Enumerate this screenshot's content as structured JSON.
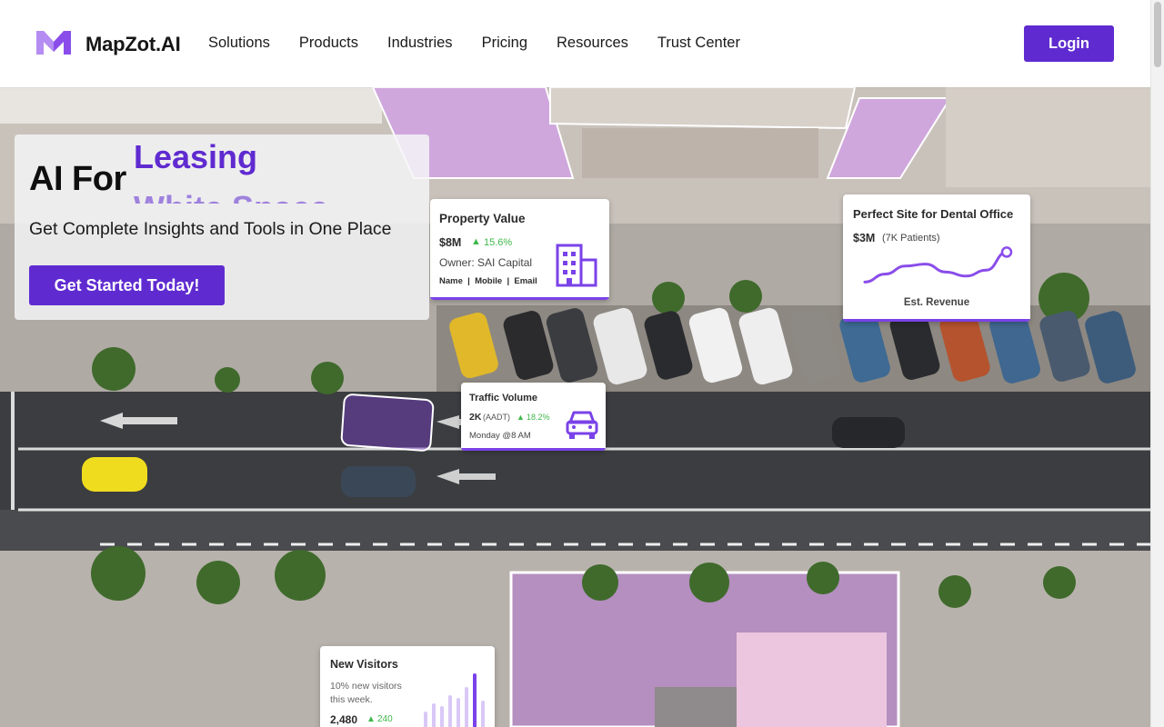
{
  "brand": {
    "name": "MapZot.AI",
    "logo_icon": "m-logo-icon",
    "accent": "#5f2bd0"
  },
  "nav": {
    "items": [
      {
        "label": "Solutions"
      },
      {
        "label": "Products"
      },
      {
        "label": "Industries"
      },
      {
        "label": "Pricing"
      },
      {
        "label": "Resources"
      },
      {
        "label": "Trust Center"
      }
    ],
    "login_label": "Login"
  },
  "hero": {
    "prefix": "AI For",
    "rotating_words": [
      "Leasing",
      "White Space"
    ],
    "subtitle": "Get Complete Insights and Tools in One Place",
    "cta_label": "Get Started Today!"
  },
  "cards": {
    "property": {
      "title": "Property Value",
      "value": "$8M",
      "change": "15.6%",
      "owner": "Owner: SAI Capital",
      "fields": "Name  |  Mobile  |  Email",
      "icon": "building-icon"
    },
    "dental": {
      "title": "Perfect Site for Dental Office",
      "value": "$3M",
      "detail": "(7K Patients)",
      "caption": "Est. Revenue",
      "trend": [
        0.15,
        0.35,
        0.55,
        0.6,
        0.4,
        0.3,
        0.45,
        0.9
      ]
    },
    "traffic": {
      "title": "Traffic Volume",
      "value": "2K",
      "unit": "(AADT)",
      "change": "18.2%",
      "time": "Monday @8 AM",
      "icon": "car-icon"
    },
    "visitors": {
      "title": "New Visitors",
      "detail_line1": "10% new visitors",
      "detail_line2": "this week.",
      "value": "2,480",
      "change": "240",
      "bars": [
        0.3,
        0.45,
        0.4,
        0.6,
        0.55,
        0.75,
        1.0,
        0.5
      ]
    }
  }
}
